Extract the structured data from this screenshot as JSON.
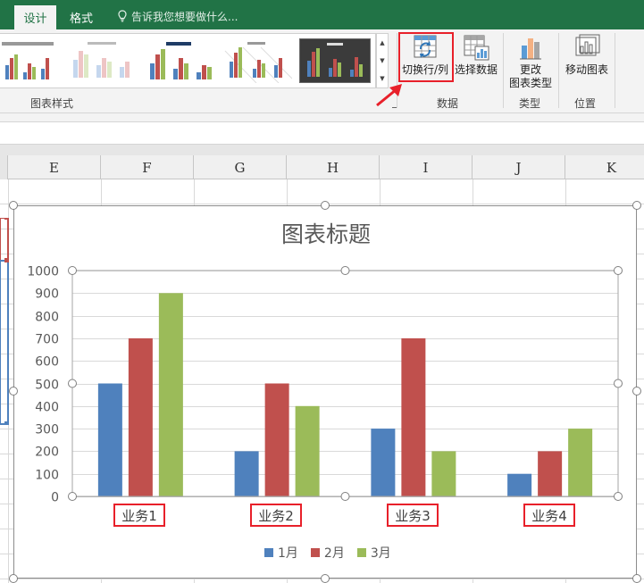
{
  "ribbon_tabs": [
    {
      "label": "设计",
      "active": true
    },
    {
      "label": "格式",
      "active": false
    }
  ],
  "tell_me": "告诉我您想要做什么...",
  "groups": {
    "chart_styles": "图表样式",
    "data": "数据",
    "type": "类型",
    "location": "位置"
  },
  "buttons": {
    "switch_row_col": "切换行/列",
    "select_data": "选择数据",
    "change_type_1": "更改",
    "change_type_2": "图表类型",
    "move_chart": "移动图表"
  },
  "columns": [
    "E",
    "F",
    "G",
    "H",
    "I",
    "J",
    "K"
  ],
  "colors": {
    "accent": "#217346",
    "series_1": "#4f81bd",
    "series_2": "#c0504d",
    "series_3": "#9bbb59",
    "highlight": "#e8202a"
  },
  "chart_data": {
    "type": "bar",
    "title": "图表标题",
    "categories": [
      "业务1",
      "业务2",
      "业务3",
      "业务4"
    ],
    "series": [
      {
        "name": "1月",
        "values": [
          500,
          200,
          300,
          100
        ]
      },
      {
        "name": "2月",
        "values": [
          700,
          500,
          700,
          200
        ]
      },
      {
        "name": "3月",
        "values": [
          900,
          400,
          200,
          300
        ]
      }
    ],
    "ylim": [
      0,
      1000
    ],
    "yticks": [
      0,
      100,
      200,
      300,
      400,
      500,
      600,
      700,
      800,
      900,
      1000
    ],
    "grid": true,
    "legend": "bottom"
  }
}
